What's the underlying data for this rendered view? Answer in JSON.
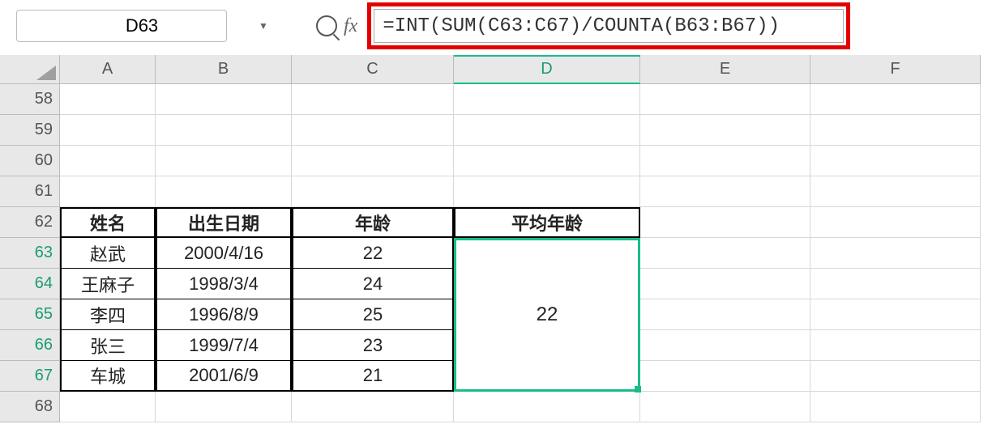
{
  "nameBox": {
    "value": "D63"
  },
  "fxLabel": "fx",
  "formula": "=INT(SUM(C63:C67)/COUNTA(B63:B67))",
  "columns": [
    "A",
    "B",
    "C",
    "D",
    "E",
    "F"
  ],
  "rows": [
    "58",
    "59",
    "60",
    "61",
    "62",
    "63",
    "64",
    "65",
    "66",
    "67",
    "68"
  ],
  "selectedRows": [
    "63",
    "64",
    "65",
    "66",
    "67"
  ],
  "headers": {
    "A": "姓名",
    "B": "出生日期",
    "C": "年龄",
    "D": "平均年龄"
  },
  "data": [
    {
      "A": "赵武",
      "B": "2000/4/16",
      "C": "22"
    },
    {
      "A": "王麻子",
      "B": "1998/3/4",
      "C": "24"
    },
    {
      "A": "李四",
      "B": "1996/8/9",
      "C": "25"
    },
    {
      "A": "张三",
      "B": "1999/7/4",
      "C": "23"
    },
    {
      "A": "车城",
      "B": "2001/6/9",
      "C": "21"
    }
  ],
  "mergedD": "22"
}
